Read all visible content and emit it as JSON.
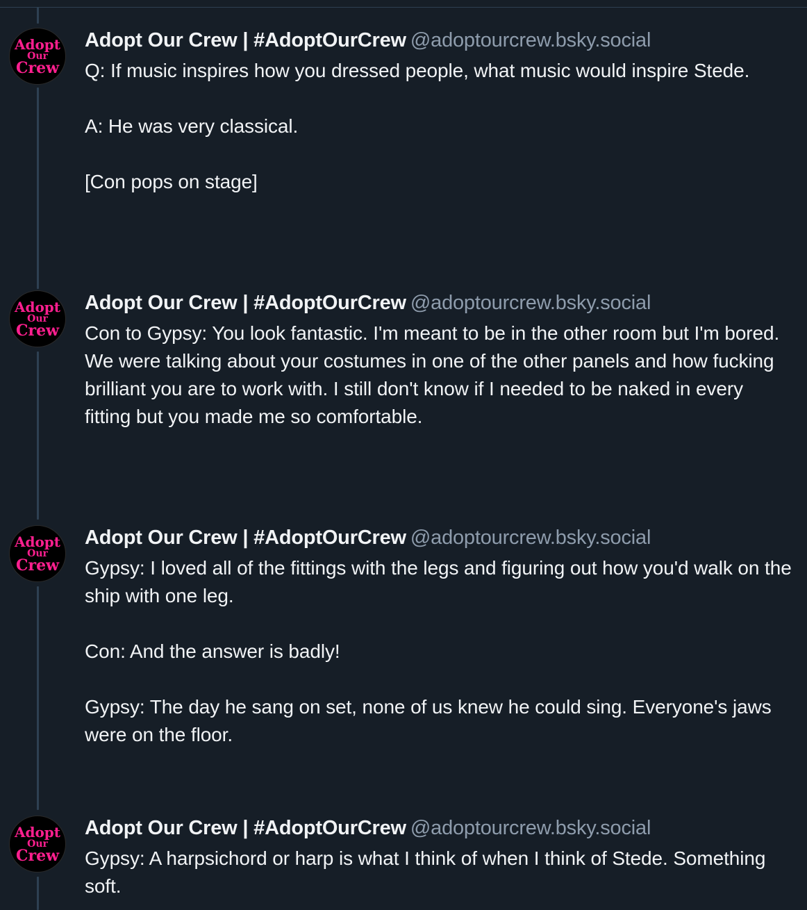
{
  "thread": {
    "posts": [
      {
        "avatar_alt": "Adopt Our Crew logo",
        "avatar_lines": [
          "Adopt",
          "Our",
          "Crew"
        ],
        "display_name": "Adopt Our Crew | #AdoptOurCrew",
        "handle": "@adoptourcrew.bsky.social",
        "text": "Q: If music inspires how you dressed people, what music would inspire Stede.\n\nA: He was very classical.\n\n[Con pops on stage]"
      },
      {
        "avatar_alt": "Adopt Our Crew logo",
        "avatar_lines": [
          "Adopt",
          "Our",
          "Crew"
        ],
        "display_name": "Adopt Our Crew | #AdoptOurCrew",
        "handle": "@adoptourcrew.bsky.social",
        "text": "Con to Gypsy: You look fantastic. I'm meant to be in the other room but I'm bored. We were talking about your costumes in one of the other panels and how fucking brilliant you are to work with. I still don't know if I needed to be naked in every fitting but you made me so comfortable."
      },
      {
        "avatar_alt": "Adopt Our Crew logo",
        "avatar_lines": [
          "Adopt",
          "Our",
          "Crew"
        ],
        "display_name": "Adopt Our Crew | #AdoptOurCrew",
        "handle": "@adoptourcrew.bsky.social",
        "text": "Gypsy: I loved all of the fittings with the legs and figuring out how you'd walk on the ship with one leg.\n\nCon: And the answer is badly!\n\nGypsy: The day he sang on set, none of us knew he could sing. Everyone's jaws were on the floor."
      },
      {
        "avatar_alt": "Adopt Our Crew logo",
        "avatar_lines": [
          "Adopt",
          "Our",
          "Crew"
        ],
        "display_name": "Adopt Our Crew | #AdoptOurCrew",
        "handle": "@adoptourcrew.bsky.social",
        "text": "Gypsy: A harpsichord or harp is what I think of when I think of Stede. Something soft."
      }
    ]
  },
  "colors": {
    "background": "#161e27",
    "thread_line": "#2e4052",
    "text": "#f1f3f5",
    "handle": "#8e9cac",
    "logo_pink": "#ff1f8f"
  }
}
